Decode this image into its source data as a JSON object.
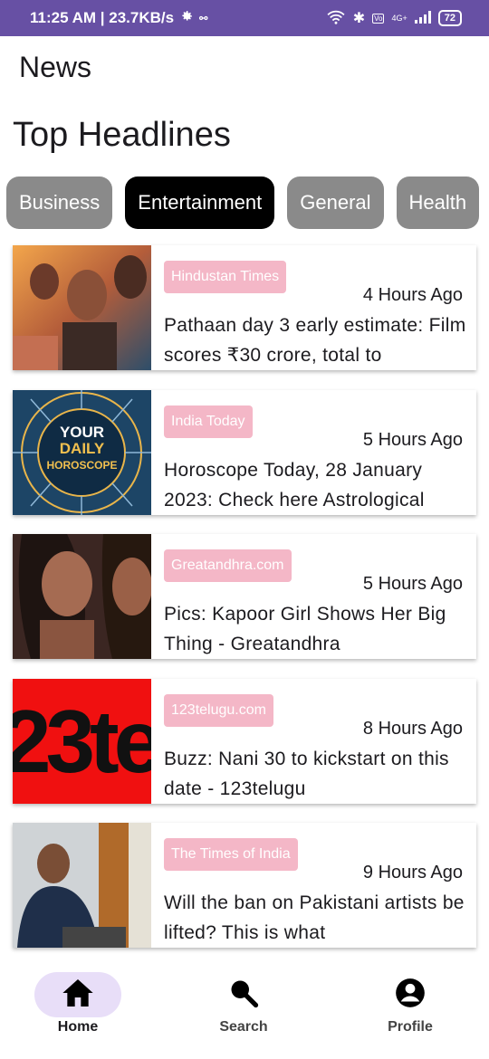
{
  "status": {
    "time_speed": "11:25 AM | 23.7KB/s",
    "battery": "72",
    "network": "4G+"
  },
  "app": {
    "title": "News",
    "section_title": "Top Headlines"
  },
  "categories": [
    "Business",
    "Entertainment",
    "General",
    "Health"
  ],
  "selected_category": "Entertainment",
  "articles": [
    {
      "source": "Hindustan Times",
      "time": "4 Hours Ago",
      "title": "Pathaan day 3 early estimate: Film scores ₹30 crore, total to"
    },
    {
      "source": "India Today",
      "time": "5 Hours Ago",
      "title": "Horoscope Today, 28 January 2023: Check here Astrological"
    },
    {
      "source": "Greatandhra.com",
      "time": "5 Hours Ago",
      "title": "Pics: Kapoor Girl Shows Her Big Thing - Greatandhra"
    },
    {
      "source": "123telugu.com",
      "time": "8 Hours Ago",
      "title": "Buzz: Nani 30 to kickstart on this date - 123telugu"
    },
    {
      "source": "The Times of India",
      "time": "9 Hours Ago",
      "title": "Will the ban on Pakistani artists be lifted? This is what"
    }
  ],
  "thumbs": {
    "horoscope_line1": "YOUR",
    "horoscope_line2": "DAILY",
    "horoscope_line3": "HOROSCOPE",
    "logo_text": "23te"
  },
  "nav": [
    {
      "label": "Home",
      "icon": "home-icon",
      "active": true
    },
    {
      "label": "Search",
      "icon": "search-icon",
      "active": false
    },
    {
      "label": "Profile",
      "icon": "account-icon",
      "active": false
    }
  ],
  "colors": {
    "statusbar": "#6750a4",
    "badge": "#f4b7c7",
    "chip": "#8a8a8a",
    "chip_selected": "#000000",
    "nav_active": "#e8def8"
  }
}
